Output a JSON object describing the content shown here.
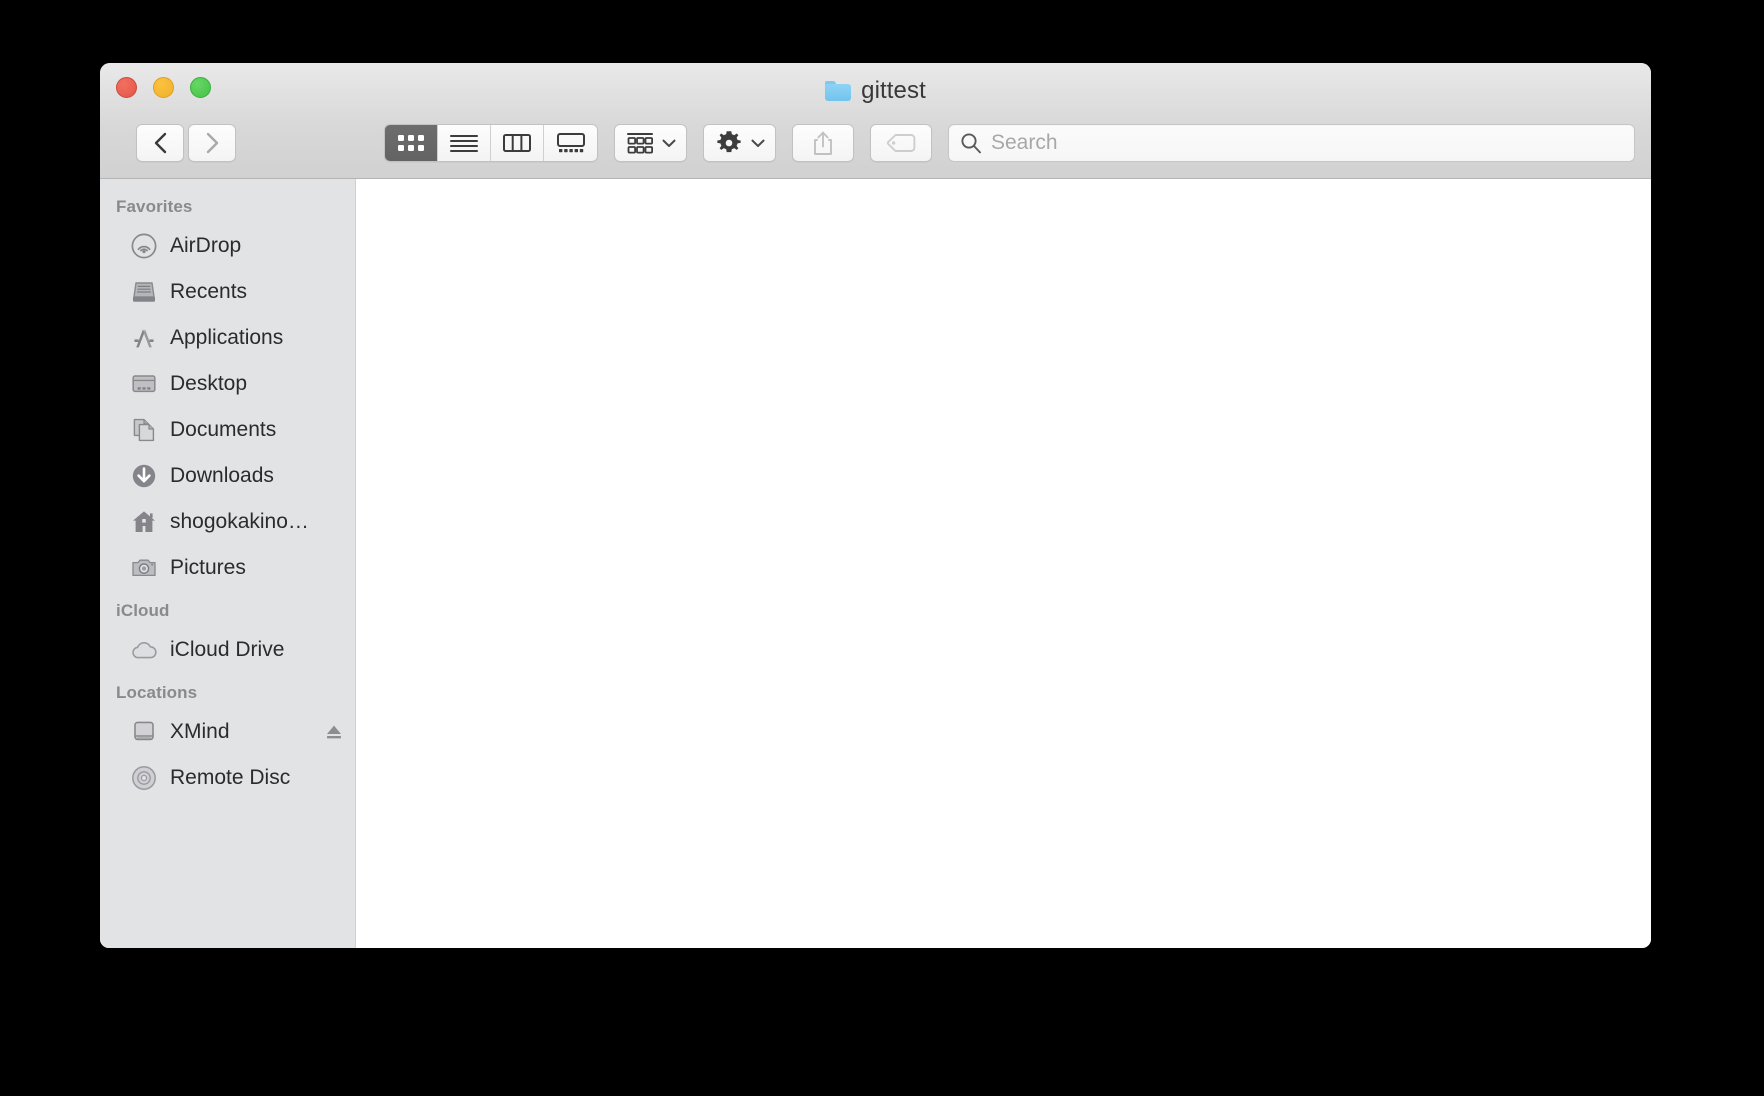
{
  "window": {
    "title": "gittest",
    "title_icon": "blue-folder-icon",
    "traffic_lights": {
      "close_label": "Close",
      "minimize_label": "Minimize",
      "maximize_label": "Zoom"
    }
  },
  "toolbar": {
    "back_label": "Back",
    "forward_label": "Forward",
    "view_modes": [
      {
        "id": "icon",
        "label": "Icon View",
        "icon": "grid-icon",
        "selected": true
      },
      {
        "id": "list",
        "label": "List View",
        "icon": "list-lines-icon",
        "selected": false
      },
      {
        "id": "column",
        "label": "Column View",
        "icon": "columns-icon",
        "selected": false
      },
      {
        "id": "gallery",
        "label": "Gallery View",
        "icon": "gallery-icon",
        "selected": false
      }
    ],
    "arrange_label": "Arrange By",
    "arrange_icon": "group-grid-icon",
    "action_label": "Action",
    "action_icon": "gear-icon",
    "share_label": "Share",
    "share_icon": "share-up-arrow-icon",
    "tags_label": "Edit Tags",
    "tags_icon": "tag-icon",
    "chevron_icon": "chevron-down-icon"
  },
  "search": {
    "placeholder": "Search",
    "value": "",
    "icon": "search-magnifier-icon"
  },
  "sidebar": {
    "sections": [
      {
        "header": "Favorites",
        "items": [
          {
            "label": "AirDrop",
            "icon": "airdrop-icon",
            "eject": false
          },
          {
            "label": "Recents",
            "icon": "recents-icon",
            "eject": false
          },
          {
            "label": "Applications",
            "icon": "applications-icon",
            "eject": false
          },
          {
            "label": "Desktop",
            "icon": "desktop-icon",
            "eject": false
          },
          {
            "label": "Documents",
            "icon": "documents-icon",
            "eject": false
          },
          {
            "label": "Downloads",
            "icon": "downloads-icon",
            "eject": false
          },
          {
            "label": "shogokakino…",
            "icon": "home-icon",
            "eject": false
          },
          {
            "label": "Pictures",
            "icon": "pictures-icon",
            "eject": false
          }
        ]
      },
      {
        "header": "iCloud",
        "items": [
          {
            "label": "iCloud Drive",
            "icon": "cloud-icon",
            "eject": false
          }
        ]
      },
      {
        "header": "Locations",
        "items": [
          {
            "label": "XMind",
            "icon": "hard-drive-icon",
            "eject": true
          },
          {
            "label": "Remote Disc",
            "icon": "optical-disc-icon",
            "eject": false
          }
        ]
      }
    ]
  },
  "content": {
    "empty": true,
    "items": []
  },
  "colors": {
    "titlebar_top": "#e9e9e9",
    "titlebar_bottom": "#d1d1d1",
    "sidebar_bg": "#e2e3e5",
    "content_bg": "#ffffff",
    "selected_segment": "#696969",
    "folder_blue": "#7ec9f0",
    "icon_gray": "#808084",
    "label_dark": "#2b2b2d",
    "header_gray": "#8a8a8e",
    "desktop_bg": "#000000"
  }
}
